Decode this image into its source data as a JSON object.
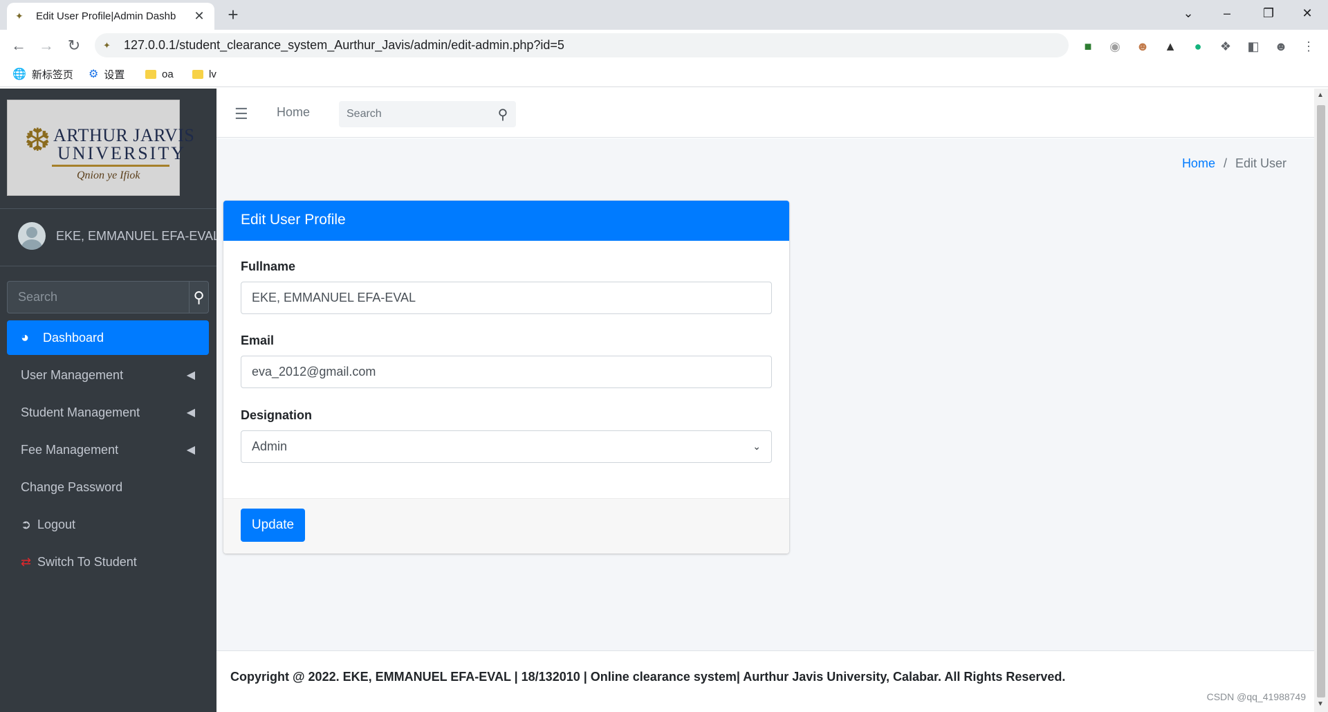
{
  "browser": {
    "tab_title": "Edit User Profile|Admin Dashb",
    "url": "127.0.0.1/student_clearance_system_Aurthur_Javis/admin/edit-admin.php?id=5",
    "bookmarks": [
      {
        "label": "新标签页"
      },
      {
        "label": "设置"
      },
      {
        "label": "oa"
      },
      {
        "label": "lv"
      }
    ]
  },
  "brand": {
    "line1": "ARTHUR JARVIS",
    "line2": "UNIVERSITY",
    "motto": "Qnion ye Ifiok"
  },
  "sidebar": {
    "user_name": "EKE, EMMANUEL EFA-EVAL",
    "search_placeholder": "Search",
    "items": [
      {
        "label": "Dashboard",
        "icon": "tachometer-icon",
        "active": true
      },
      {
        "label": "User Management",
        "icon": "",
        "has_submenu": true
      },
      {
        "label": "Student Management",
        "icon": "",
        "has_submenu": true
      },
      {
        "label": "Fee Management",
        "icon": "",
        "has_submenu": true
      },
      {
        "label": "Change Password",
        "icon": ""
      },
      {
        "label": "Logout",
        "icon": "sign-out-icon"
      },
      {
        "label": "Switch To Student",
        "icon": "exchange-icon"
      }
    ]
  },
  "topnav": {
    "home_label": "Home",
    "search_placeholder": "Search"
  },
  "breadcrumb": {
    "home": "Home",
    "separator": "/",
    "current": "Edit User"
  },
  "form": {
    "title": "Edit User Profile",
    "fullname_label": "Fullname",
    "fullname_value": "EKE, EMMANUEL EFA-EVAL",
    "email_label": "Email",
    "email_value": "eva_2012@gmail.com",
    "designation_label": "Designation",
    "designation_value": "Admin",
    "submit_label": "Update"
  },
  "footer": {
    "copyright": "Copyright @ 2022. EKE, EMMANUEL EFA-EVAL | 18/132010 | Online clearance system| Aurthur Javis University, Calabar. All Rights Reserved.",
    "watermark": "CSDN @qq_41988749"
  },
  "colors": {
    "primary": "#007bff",
    "sidebar_bg": "#343a40",
    "content_bg": "#f4f6f9",
    "switch_icon": "#e3262b"
  }
}
